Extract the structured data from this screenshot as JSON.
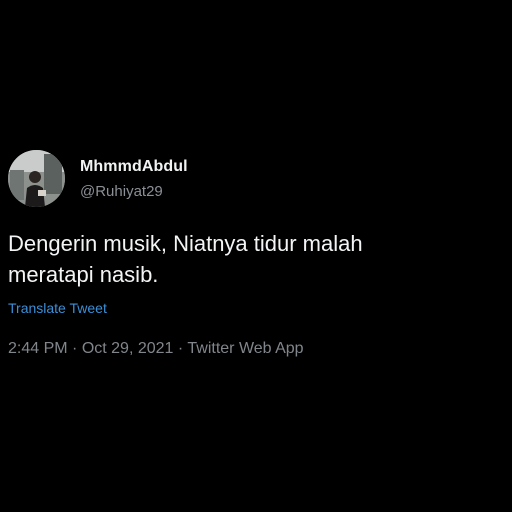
{
  "tweet": {
    "author": {
      "display_name": "MhmmdAbdul",
      "handle": "@Ruhiyat29",
      "avatar_icon": "user-avatar-photo"
    },
    "text": "Dengerin musik, Niatnya tidur malah\nmeratapi nasib.",
    "translate_label": "Translate Tweet",
    "time": "2:44 PM",
    "separator": " · ",
    "date": "Oct 29, 2021",
    "source": "Twitter Web App"
  },
  "colors": {
    "background": "#000000",
    "text_primary": "#f2f4f5",
    "text_secondary": "#80868b",
    "link": "#3b8fd8"
  }
}
